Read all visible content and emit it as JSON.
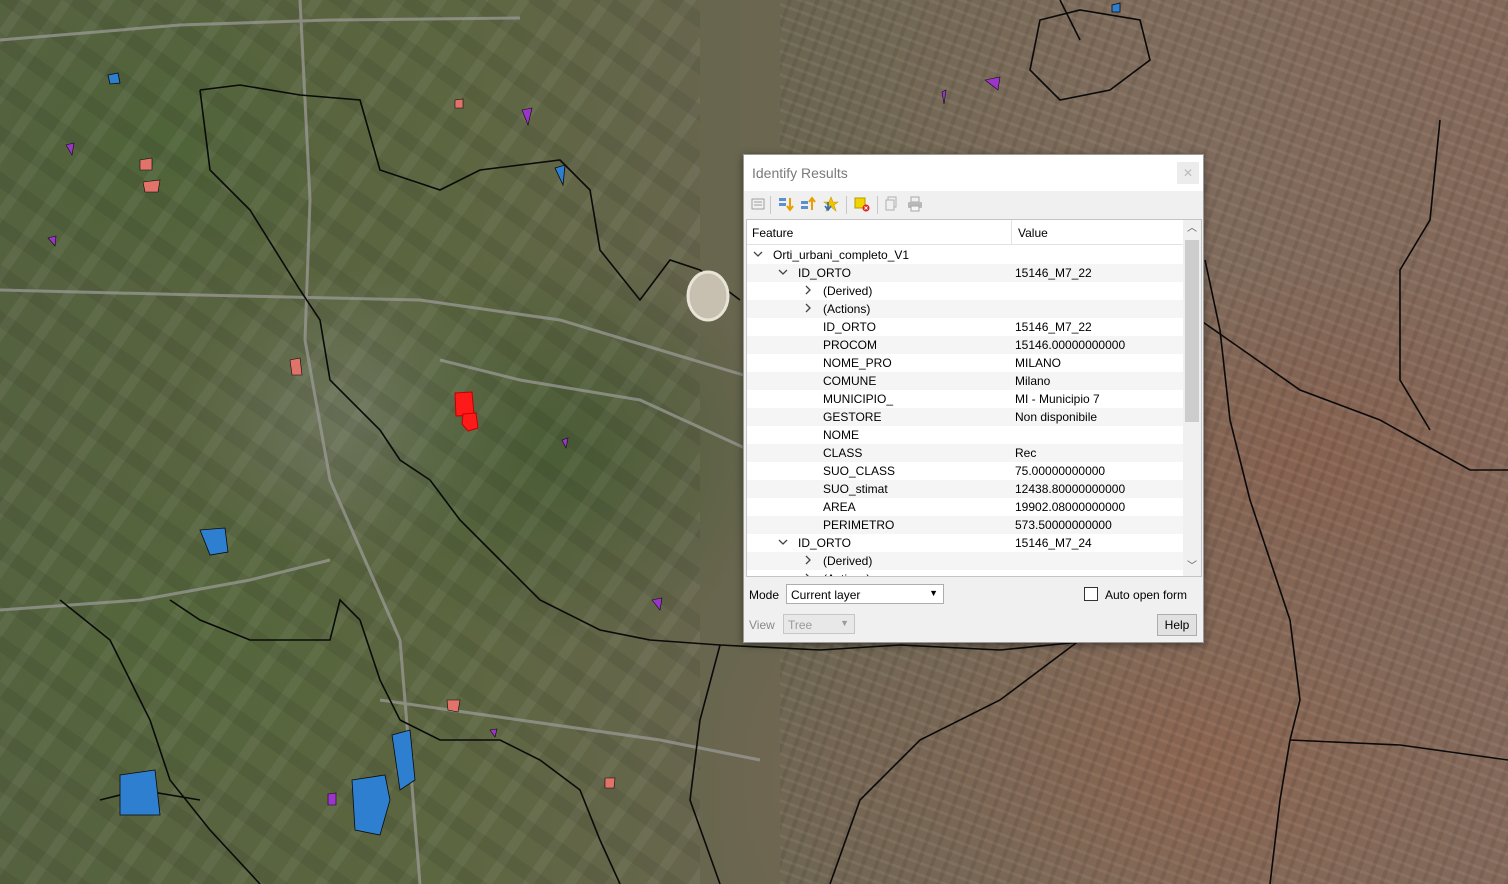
{
  "dialog": {
    "title": "Identify Results",
    "close_icon": "close-icon",
    "toolbar": [
      {
        "name": "expand-tree-icon"
      },
      {
        "name": "expand-all-icon"
      },
      {
        "name": "collapse-all-icon"
      },
      {
        "name": "expand-new-results-icon"
      },
      {
        "name": "clear-results-icon"
      },
      {
        "name": "copy-feature-icon"
      },
      {
        "name": "print-icon"
      }
    ],
    "columns": {
      "feature": "Feature",
      "value": "Value"
    },
    "rows": [
      {
        "label": "Orti_urbani_completo_V1",
        "value": "",
        "depth": 0,
        "expander": "down"
      },
      {
        "label": "ID_ORTO",
        "value": "15146_M7_22",
        "depth": 1,
        "expander": "down"
      },
      {
        "label": "(Derived)",
        "value": "",
        "depth": 2,
        "expander": "right"
      },
      {
        "label": "(Actions)",
        "value": "",
        "depth": 2,
        "expander": "right"
      },
      {
        "label": "ID_ORTO",
        "value": "15146_M7_22",
        "depth": 2,
        "expander": ""
      },
      {
        "label": "PROCOM",
        "value": "15146.00000000000",
        "depth": 2,
        "expander": ""
      },
      {
        "label": "NOME_PRO",
        "value": "MILANO",
        "depth": 2,
        "expander": ""
      },
      {
        "label": "COMUNE",
        "value": "Milano",
        "depth": 2,
        "expander": ""
      },
      {
        "label": "MUNICIPIO_",
        "value": "MI - Municipio 7",
        "depth": 2,
        "expander": ""
      },
      {
        "label": "GESTORE",
        "value": "Non disponibile",
        "depth": 2,
        "expander": ""
      },
      {
        "label": "NOME",
        "value": "",
        "depth": 2,
        "expander": ""
      },
      {
        "label": "CLASS",
        "value": "Rec",
        "depth": 2,
        "expander": ""
      },
      {
        "label": "SUO_CLASS",
        "value": "75.00000000000",
        "depth": 2,
        "expander": ""
      },
      {
        "label": "SUO_stimat",
        "value": "12438.80000000000",
        "depth": 2,
        "expander": ""
      },
      {
        "label": "AREA",
        "value": "19902.08000000000",
        "depth": 2,
        "expander": ""
      },
      {
        "label": "PERIMETRO",
        "value": "573.50000000000",
        "depth": 2,
        "expander": ""
      },
      {
        "label": "ID_ORTO",
        "value": "15146_M7_24",
        "depth": 1,
        "expander": "down"
      },
      {
        "label": "(Derived)",
        "value": "",
        "depth": 2,
        "expander": "right"
      },
      {
        "label": "(Actions)",
        "value": "",
        "depth": 2,
        "expander": "right"
      }
    ],
    "mode": {
      "label": "Mode",
      "value": "Current layer"
    },
    "auto_open": {
      "label": "Auto open form",
      "checked": false
    },
    "view": {
      "label": "View",
      "value": "Tree"
    },
    "help_label": "Help"
  }
}
